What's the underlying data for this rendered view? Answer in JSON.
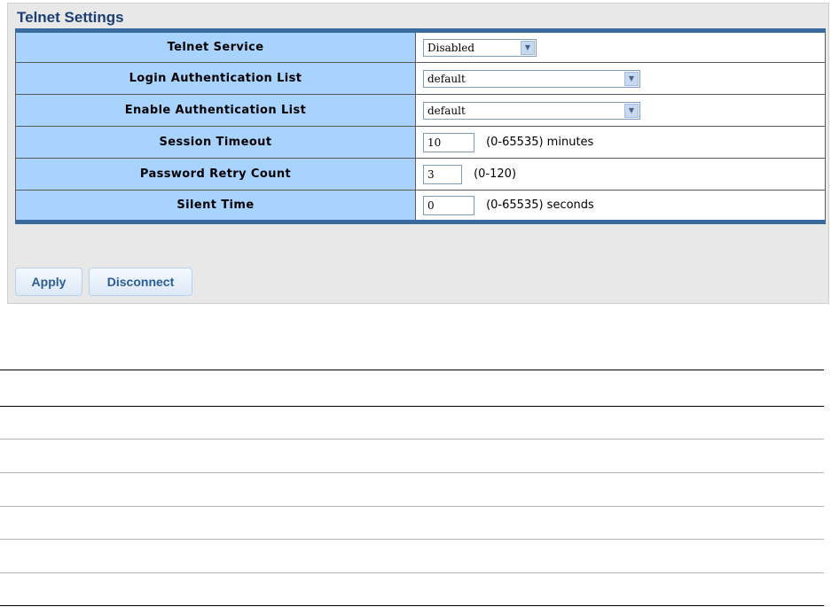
{
  "panel": {
    "title": "Telnet Settings"
  },
  "settings": [
    {
      "label": "Telnet Service",
      "control": "select",
      "value": "Disabled"
    },
    {
      "label": "Login Authentication List",
      "control": "select",
      "value": "default"
    },
    {
      "label": "Enable Authentication List",
      "control": "select",
      "value": "default"
    },
    {
      "label": "Session Timeout",
      "control": "text",
      "value": "10",
      "hint": "(0-65535) minutes"
    },
    {
      "label": "Password Retry Count",
      "control": "text",
      "value": "3",
      "hint": "(0-120)"
    },
    {
      "label": "Silent Time",
      "control": "text",
      "value": "0",
      "hint": "(0-65535) seconds"
    }
  ],
  "buttons": {
    "apply": "Apply",
    "disconnect": "Disconnect"
  },
  "icons": {
    "dropdown": "chevron-down-icon"
  },
  "colors": {
    "title": "#1c3f73",
    "label_bg": "#a9d3ff",
    "table_border": "#3a6b9f",
    "button_text": "#2a5d96"
  }
}
